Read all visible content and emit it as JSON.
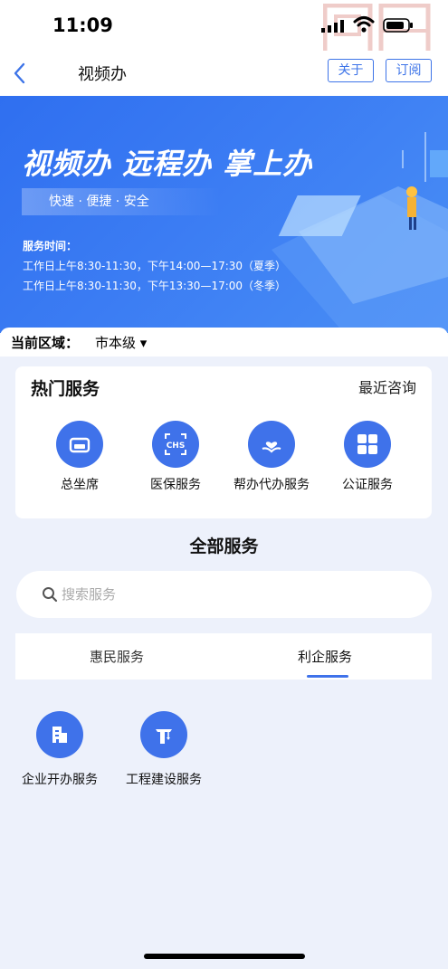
{
  "status": {
    "time": "11:09"
  },
  "nav": {
    "title": "视频办",
    "about_label": "关于",
    "subscribe_label": "订阅"
  },
  "banner": {
    "headline": "视频办 远程办 掌上办",
    "tagline": "快速 · 便捷 · 安全",
    "hours_title": "服务时间：",
    "hours_summer": "工作日上午8:30-11:30，下午14:00—17:30（夏季）",
    "hours_winter": "工作日上午8:30-11:30，下午13:30—17:00（冬季）"
  },
  "region": {
    "label": "当前区域：",
    "value": "市本级 ▾"
  },
  "hot_services": {
    "title": "热门服务",
    "recent_link": "最近咨询",
    "items": [
      {
        "label": "总坐席",
        "icon": "sofa-icon"
      },
      {
        "label": "医保服务",
        "icon": "chs-icon"
      },
      {
        "label": "帮办代办服务",
        "icon": "hand-heart-icon"
      },
      {
        "label": "公证服务",
        "icon": "grid-icon"
      }
    ]
  },
  "all_services": {
    "title": "全部服务"
  },
  "search": {
    "placeholder": "搜索服务"
  },
  "tabs": [
    {
      "label": "惠民服务",
      "active": false
    },
    {
      "label": "利企服务",
      "active": true
    }
  ],
  "business_services": [
    {
      "label": "企业开办服务",
      "icon": "building-icon"
    },
    {
      "label": "工程建设服务",
      "icon": "crane-icon"
    }
  ],
  "colors": {
    "accent": "#3f72ea",
    "page_bg": "#edf1fb",
    "banner_start": "#2f6ff0",
    "banner_end": "#4a8ff5"
  }
}
